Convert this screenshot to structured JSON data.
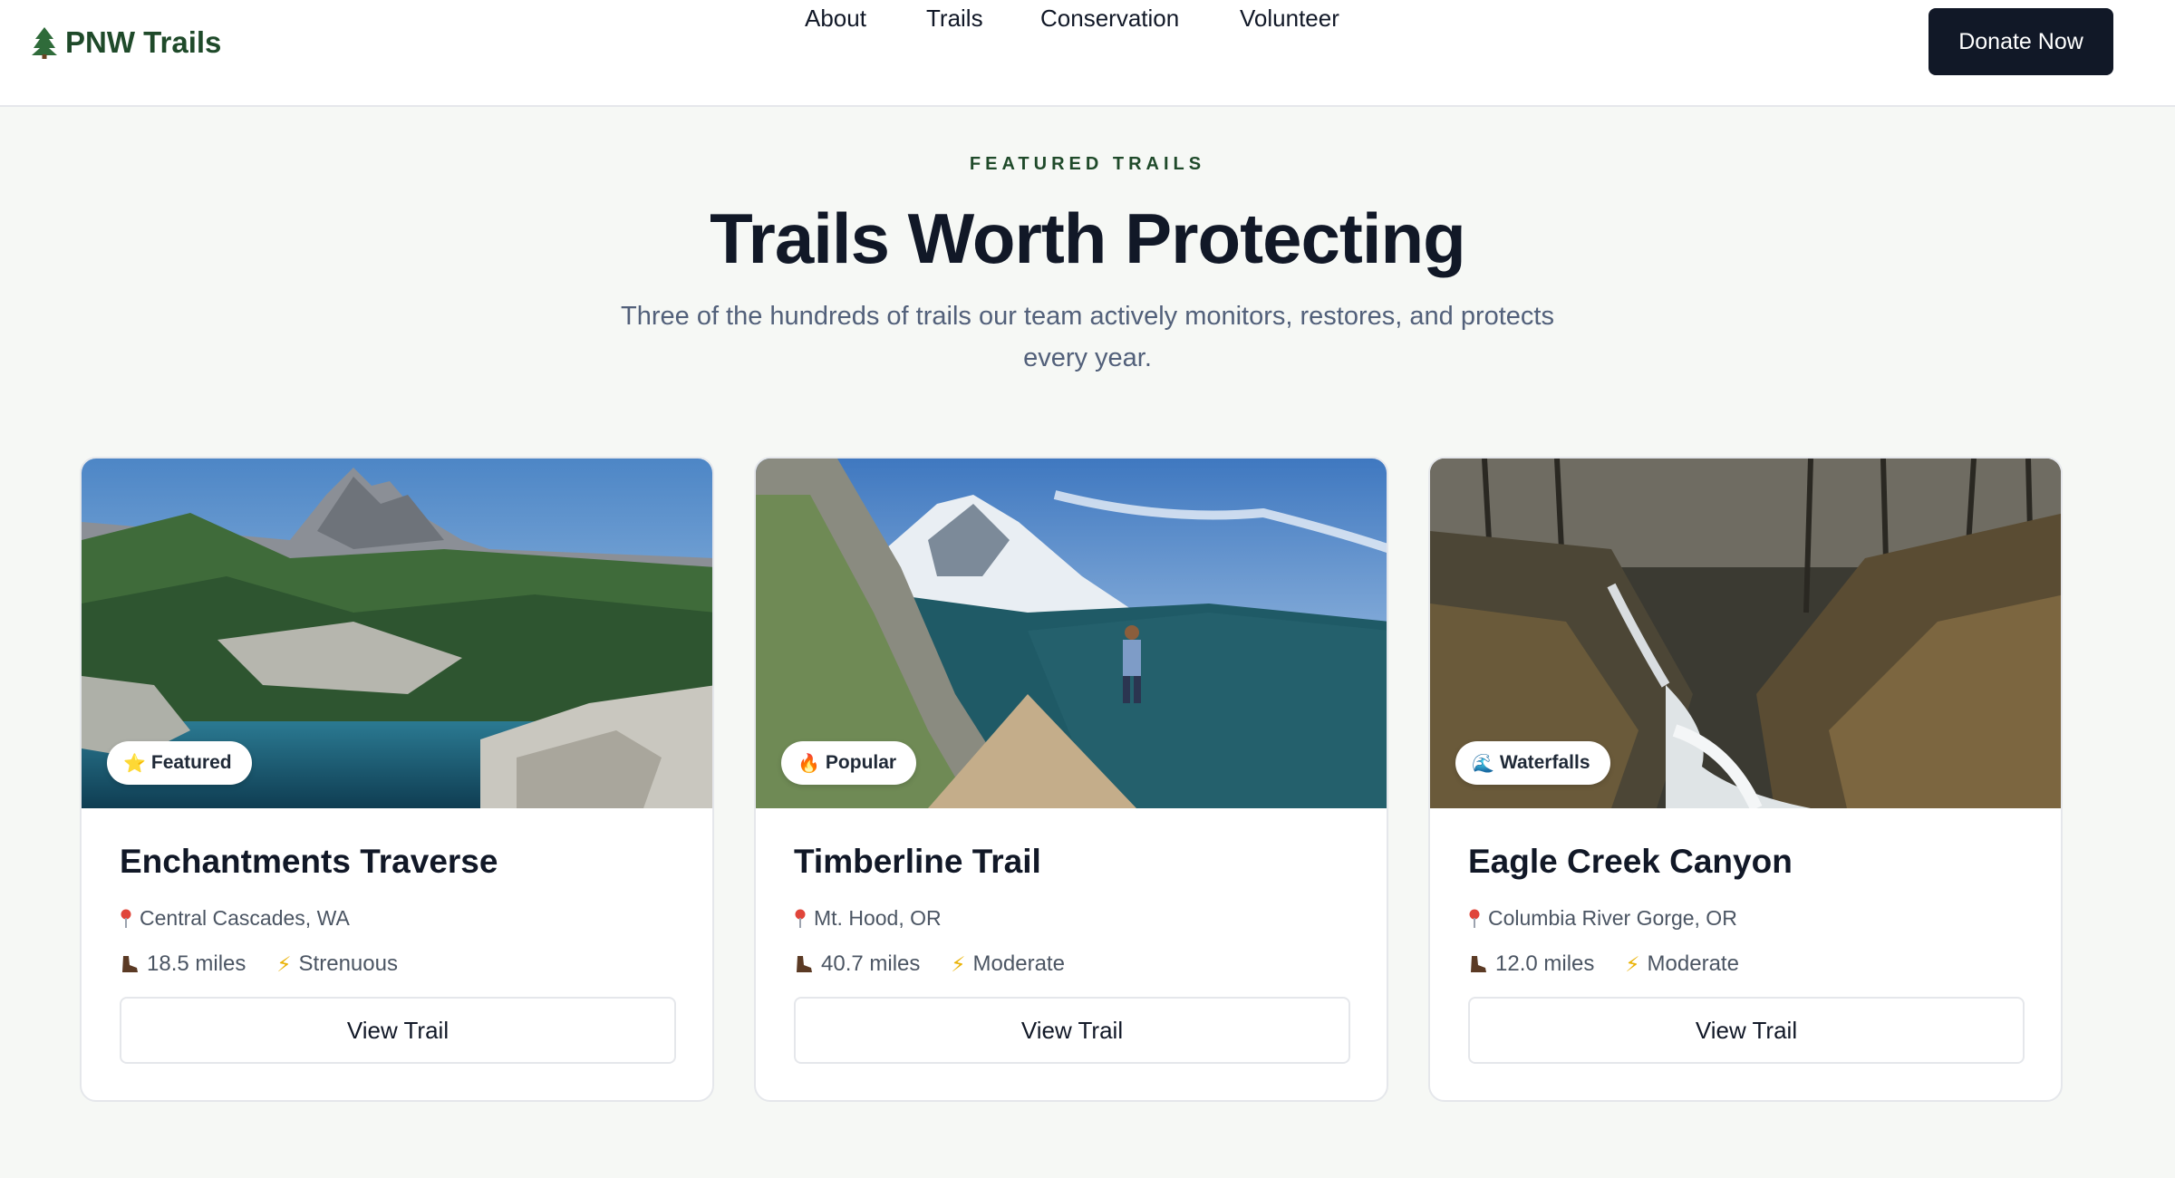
{
  "brand": {
    "name": "PNW Trails",
    "icon": "pine-tree-icon",
    "color": "#1f4a2a"
  },
  "nav": {
    "items": [
      "About",
      "Trails",
      "Conservation",
      "Volunteer"
    ]
  },
  "header": {
    "donate_label": "Donate Now"
  },
  "hero": {
    "eyebrow": "FEATURED TRAILS",
    "title": "Trails Worth Protecting",
    "subtitle": "Three of the hundreds of trails our team actively monitors, restores, and protects every year."
  },
  "cards": [
    {
      "badge": "Featured",
      "badge_icon": "star-icon",
      "title": "Enchantments Traverse",
      "location": "Central Cascades, WA",
      "distance": "18.5 miles",
      "difficulty": "Strenuous",
      "cta": "View Trail"
    },
    {
      "badge": "Popular",
      "badge_icon": "fire-icon",
      "title": "Timberline Trail",
      "location": "Mt. Hood, OR",
      "distance": "40.7 miles",
      "difficulty": "Moderate",
      "cta": "View Trail"
    },
    {
      "badge": "Waterfalls",
      "badge_icon": "wave-icon",
      "title": "Eagle Creek Canyon",
      "location": "Columbia River Gorge, OR",
      "distance": "12.0 miles",
      "difficulty": "Moderate",
      "cta": "View Trail"
    }
  ],
  "colors": {
    "accent": "#111827",
    "page_bg": "#f6f8f5",
    "muted_text": "#52607a"
  }
}
